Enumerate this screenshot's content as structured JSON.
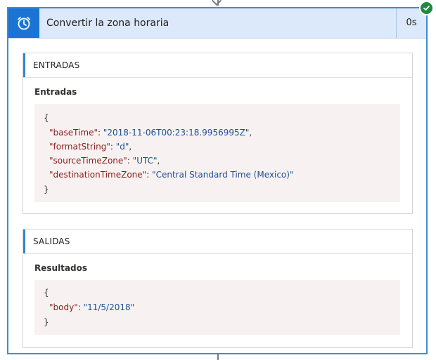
{
  "action": {
    "title": "Convertir la zona horaria",
    "duration": "0s",
    "icon": "alarm-clock-icon",
    "status_icon": "success-check-icon",
    "colors": {
      "accent": "#1b74d3",
      "header_bg": "#dce9fb",
      "border": "#3f8bd9",
      "success": "#1e8a3e"
    }
  },
  "inputs": {
    "section_title": "ENTRADAS",
    "label": "Entradas",
    "open_brace": "{",
    "close_brace": "}",
    "lines": [
      {
        "key": "\"baseTime\"",
        "sep": ": ",
        "value": "\"2018-11-06T00:23:18.9956995Z\"",
        "end": ","
      },
      {
        "key": "\"formatString\"",
        "sep": ": ",
        "value": "\"d\"",
        "end": ","
      },
      {
        "key": "\"sourceTimeZone\"",
        "sep": ": ",
        "value": "\"UTC\"",
        "end": ","
      },
      {
        "key": "\"destinationTimeZone\"",
        "sep": ": ",
        "value": "\"Central Standard Time (Mexico)\"",
        "end": ""
      }
    ]
  },
  "outputs": {
    "section_title": "SALIDAS",
    "label": "Resultados",
    "open_brace": "{",
    "close_brace": "}",
    "lines": [
      {
        "key": "\"body\"",
        "sep": ": ",
        "value": "\"11/5/2018\"",
        "end": ""
      }
    ]
  }
}
